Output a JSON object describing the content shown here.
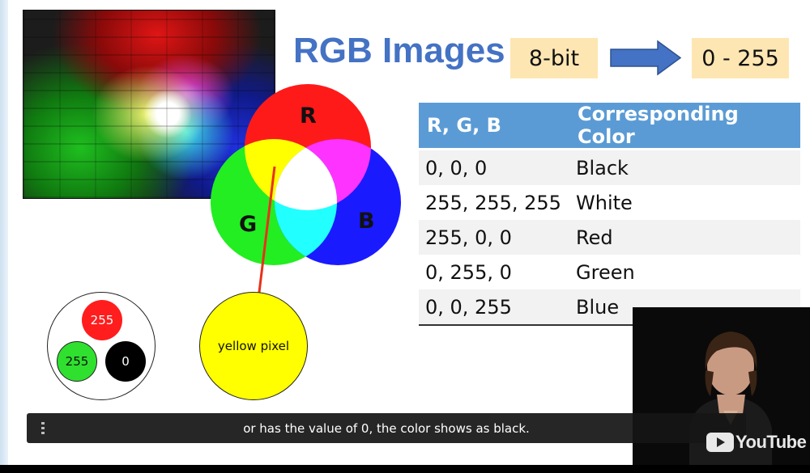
{
  "slide": {
    "title": "RGB Images",
    "bit_depth_label": "8-bit",
    "range_label": "0 - 255",
    "venn_labels": {
      "red": "R",
      "green": "G",
      "blue": "B"
    },
    "table": {
      "headers": [
        "R, G, B",
        "Corresponding Color"
      ],
      "rows": [
        [
          "0, 0, 0",
          "Black"
        ],
        [
          "255, 255, 255",
          "White"
        ],
        [
          "255, 0, 0",
          "Red"
        ],
        [
          "0, 255, 0",
          "Green"
        ],
        [
          "0, 0, 255",
          "Blue"
        ]
      ]
    },
    "pixel_values": {
      "red": "255",
      "green": "255",
      "blue": "0"
    },
    "result_label": "yellow pixel",
    "colors": {
      "title": "#4472c4",
      "table_header": "#5b9bd5",
      "tag_fill": "#fde6b2",
      "red": "#ff1d1d",
      "green": "#2fe02f",
      "blue": "#1a1aff",
      "yellow": "#ffff00",
      "arrow": "#e8311a"
    }
  },
  "player": {
    "caption_text": "or has the value of 0, the color shows as black.",
    "caption_menu_icon": "vertical-dots-icon",
    "brand_text": "YouTube",
    "brand_icon": "youtube-play-icon"
  }
}
